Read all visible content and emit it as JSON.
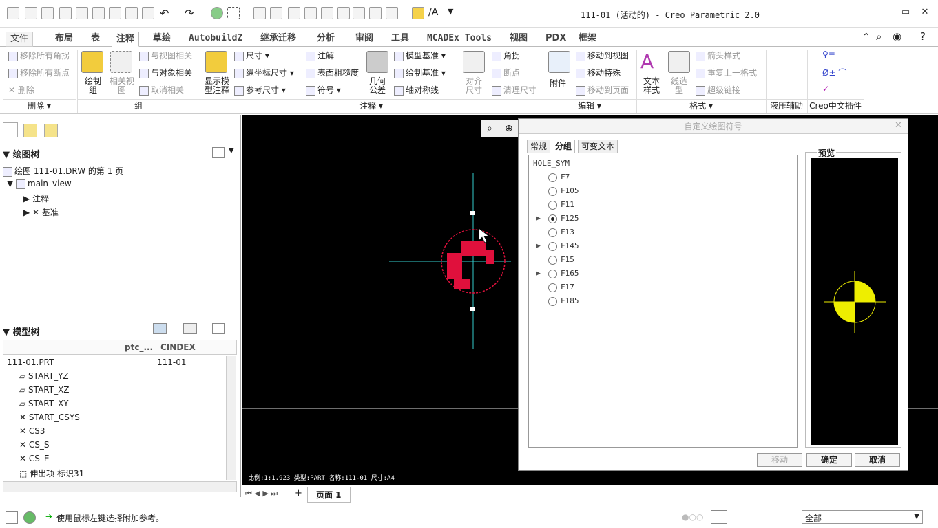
{
  "window": {
    "title": "111-01 (活动的) - Creo Parametric 2.0",
    "min": "—",
    "max": "▭",
    "close": "✕"
  },
  "tabs": [
    {
      "label": "文件"
    },
    {
      "label": "布局"
    },
    {
      "label": "表"
    },
    {
      "label": "注释"
    },
    {
      "label": "草绘"
    },
    {
      "label": "AutobuildZ"
    },
    {
      "label": "继承迁移"
    },
    {
      "label": "分析"
    },
    {
      "label": "审阅"
    },
    {
      "label": "工具"
    },
    {
      "label": "MCADEx Tools"
    },
    {
      "label": "视图"
    },
    {
      "label": "PDX"
    },
    {
      "label": "框架"
    }
  ],
  "ribbon": {
    "delete_group": {
      "remove_angles": "移除所有角拐",
      "remove_breaks": "移除所有断点",
      "delete": "删除",
      "label": "删除"
    },
    "group_group": {
      "draw_group": "绘制组",
      "related_view": "相关视图",
      "view_related": "与视图相关",
      "object_related": "与对象相关",
      "unrelate": "取消相关",
      "label": "组"
    },
    "annot_group": {
      "show_model_annot": "显示模型注释",
      "dimension": "尺寸",
      "ordinate": "纵坐标尺寸",
      "ref_dim": "参考尺寸",
      "note": "注解",
      "surface_finish": "表面粗糙度",
      "symbol": "符号",
      "geo_tol": "几何公差",
      "model_datum": "模型基准",
      "draw_datum": "绘制基准",
      "sym_line": "轴对称线",
      "align_dim": "对齐尺寸",
      "corner": "角拐",
      "break": "断点",
      "cleanup": "清理尺寸",
      "label": "注释"
    },
    "edit_group": {
      "attach": "附件",
      "move_to_view": "移动到视图",
      "move_special": "移动特殊",
      "move_to_page": "移动到页面",
      "label": "编辑"
    },
    "format_group": {
      "text_style": "文本样式",
      "line_style": "线造型",
      "arrow_style": "箭头样式",
      "repeat_format": "重复上一格式",
      "hyperlink": "超级链接",
      "label": "格式"
    },
    "hydraulic_label": "液压辅助",
    "creo_cn_label": "Creo中文插件"
  },
  "left": {
    "draw_tree_title": "绘图树",
    "draw_tree": [
      "绘图 111-01.DRW 的第 1 页",
      "main_view",
      "注释",
      "基准"
    ],
    "model_tree_title": "模型树",
    "model_tree_cols": [
      "ptc_...",
      "CINDEX"
    ],
    "model_root": "111-01.PRT",
    "model_root_val": "111-01",
    "model_items": [
      "START_YZ",
      "START_XZ",
      "START_XY",
      "START_CSYS",
      "CS3",
      "CS_S",
      "CS_E",
      "伸出项 标识31"
    ]
  },
  "canvas": {
    "info": "比例:1:1.923  类型:PART  名称:111-01  尺寸:A4"
  },
  "dialog": {
    "title": "自定义绘图符号",
    "tabs": [
      "常规",
      "分组",
      "可变文本"
    ],
    "root": "HOLE_SYM",
    "items": [
      {
        "label": "F7",
        "selected": false,
        "expandable": false
      },
      {
        "label": "F105",
        "selected": false,
        "expandable": false
      },
      {
        "label": "F11",
        "selected": false,
        "expandable": false
      },
      {
        "label": "F125",
        "selected": true,
        "expandable": true
      },
      {
        "label": "F13",
        "selected": false,
        "expandable": false
      },
      {
        "label": "F145",
        "selected": false,
        "expandable": true
      },
      {
        "label": "F15",
        "selected": false,
        "expandable": false
      },
      {
        "label": "F165",
        "selected": false,
        "expandable": true
      },
      {
        "label": "F17",
        "selected": false,
        "expandable": false
      },
      {
        "label": "F185",
        "selected": false,
        "expandable": false
      }
    ],
    "preview_label": "预览",
    "move_btn": "移动",
    "ok_btn": "确定",
    "cancel_btn": "取消"
  },
  "pagebar": {
    "page_label": "页面 1"
  },
  "status": {
    "message": "使用鼠标左键选择附加参考。",
    "filter": "全部"
  }
}
